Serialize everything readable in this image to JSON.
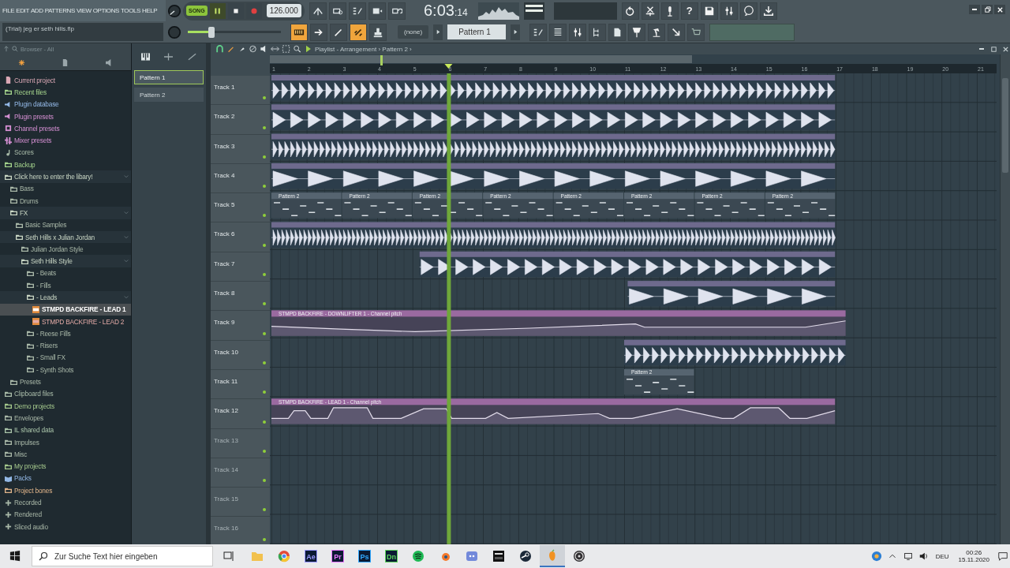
{
  "menu": [
    "FILE",
    "EDIT",
    "ADD",
    "PATTERNS",
    "VIEW",
    "OPTIONS",
    "TOOLS",
    "HELP"
  ],
  "hint": "(Trial) jeg er seth hills.flp",
  "transport": {
    "mode": "SONG",
    "playing": true,
    "tempo": "126.000"
  },
  "time": {
    "main": "6:03",
    "sub": ":14"
  },
  "master_volume": {
    "level": 0.25
  },
  "help_label": "?",
  "pattern_selector": {
    "channel": "(none)",
    "pattern": "Pattern 1"
  },
  "browser": {
    "title": "Browser - All",
    "items": [
      {
        "label": "Current project",
        "kind": "file",
        "color": "#d9a7b4"
      },
      {
        "label": "Recent files",
        "kind": "folder",
        "color": "#a4d38c"
      },
      {
        "label": "Plugin database",
        "kind": "plugin",
        "color": "#93b8e6"
      },
      {
        "label": "Plugin presets",
        "kind": "plugin",
        "color": "#d48fd2"
      },
      {
        "label": "Channel presets",
        "kind": "channel",
        "color": "#d48fd2"
      },
      {
        "label": "Mixer presets",
        "kind": "mixer",
        "color": "#d48fd2"
      },
      {
        "label": "Scores",
        "kind": "note",
        "color": "#a9bca9"
      },
      {
        "label": "Backup",
        "kind": "folder",
        "color": "#a4d38c"
      },
      {
        "label": "Click here to enter the libary!",
        "kind": "folder",
        "color": "#c9d6c4",
        "children": [
          {
            "label": "Bass",
            "kind": "folder",
            "color": "#a9b8a8"
          },
          {
            "label": "Drums",
            "kind": "folder",
            "color": "#a9b8a8"
          },
          {
            "label": "FX",
            "kind": "folder",
            "color": "#c9d6c4",
            "children": [
              {
                "label": "Basic Samples",
                "kind": "folder",
                "color": "#a9b8a8"
              },
              {
                "label": "Seth Hills x Julian Jordan",
                "kind": "folder",
                "color": "#c9d6c4",
                "children": [
                  {
                    "label": "Julian Jordan Style",
                    "kind": "folder",
                    "color": "#a9b8a8"
                  },
                  {
                    "label": "Seth Hills Style",
                    "kind": "folder",
                    "color": "#c9d6c4",
                    "children": [
                      {
                        "label": "- Beats",
                        "kind": "folder",
                        "color": "#a9b8a8"
                      },
                      {
                        "label": "- Fills",
                        "kind": "folder",
                        "color": "#a9b8a8"
                      },
                      {
                        "label": "- Leads",
                        "kind": "folder",
                        "color": "#c9d6c4",
                        "children": [
                          {
                            "label": "STMPD BACKFIRE - LEAD 1",
                            "kind": "audio",
                            "color": "#ffffff",
                            "selected": true
                          },
                          {
                            "label": "STMPD BACKFIRE - LEAD 2",
                            "kind": "audio",
                            "color": "#e3aaa6",
                            "selected": false
                          }
                        ]
                      },
                      {
                        "label": "- Reese Fills",
                        "kind": "folder",
                        "color": "#a9b8a8"
                      },
                      {
                        "label": "- Risers",
                        "kind": "folder",
                        "color": "#a9b8a8"
                      },
                      {
                        "label": "- Small FX",
                        "kind": "folder",
                        "color": "#a9b8a8"
                      },
                      {
                        "label": "- Synth Shots",
                        "kind": "folder",
                        "color": "#a9b8a8"
                      }
                    ]
                  }
                ]
              }
            ]
          },
          {
            "label": "Presets",
            "kind": "folder",
            "color": "#a9b8a8"
          }
        ]
      },
      {
        "label": "Clipboard files",
        "kind": "folder",
        "color": "#a9bca9"
      },
      {
        "label": "Demo projects",
        "kind": "folder",
        "color": "#a4c88c"
      },
      {
        "label": "Envelopes",
        "kind": "folder",
        "color": "#a9b8a8"
      },
      {
        "label": "IL shared data",
        "kind": "folder",
        "color": "#a9c4a9"
      },
      {
        "label": "Impulses",
        "kind": "folder",
        "color": "#a9b8a8"
      },
      {
        "label": "Misc",
        "kind": "folder",
        "color": "#a9b8a8"
      },
      {
        "label": "My projects",
        "kind": "folder",
        "color": "#a4c88c"
      },
      {
        "label": "Packs",
        "kind": "packs",
        "color": "#93b8e6"
      },
      {
        "label": "Project bones",
        "kind": "folder",
        "color": "#e0b48a"
      },
      {
        "label": "Recorded",
        "kind": "plus",
        "color": "#a9b8a8"
      },
      {
        "label": "Rendered",
        "kind": "plus",
        "color": "#a9b8a8"
      },
      {
        "label": "Sliced audio",
        "kind": "plus",
        "color": "#a9b8a8"
      }
    ]
  },
  "patterns": [
    {
      "label": "Pattern 1",
      "selected": true
    },
    {
      "label": "Pattern 2",
      "selected": false
    }
  ],
  "playlist": {
    "title": "Playlist - Arrangement › Pattern 2 ›",
    "bars": [
      "1",
      "2",
      "3",
      "4",
      "5",
      "6",
      "7",
      "8",
      "9",
      "10",
      "11",
      "12",
      "13",
      "14",
      "15",
      "16",
      "17",
      "18",
      "19",
      "20",
      "21"
    ],
    "tracks": [
      {
        "name": "Track 1",
        "clips": [
          {
            "kind": "audio"
          }
        ]
      },
      {
        "name": "Track 2",
        "clips": [
          {
            "kind": "audio"
          }
        ]
      },
      {
        "name": "Track 3",
        "clips": [
          {
            "kind": "audio"
          }
        ]
      },
      {
        "name": "Track 4",
        "clips": [
          {
            "kind": "audio"
          }
        ]
      },
      {
        "name": "Track 5",
        "clips": [
          {
            "kind": "pattern",
            "label": "Pattern 2"
          },
          {
            "kind": "pattern",
            "label": "Pattern 2"
          },
          {
            "kind": "pattern",
            "label": "Pattern 2"
          },
          {
            "kind": "pattern",
            "label": "Pattern 2"
          },
          {
            "kind": "pattern",
            "label": "Pattern 2"
          },
          {
            "kind": "pattern",
            "label": "Pattern 2"
          },
          {
            "kind": "pattern",
            "label": "Pattern 2"
          },
          {
            "kind": "pattern",
            "label": "Pattern 2"
          }
        ]
      },
      {
        "name": "Track 6",
        "clips": [
          {
            "kind": "audio"
          }
        ]
      },
      {
        "name": "Track 7",
        "clips": [
          {
            "kind": "audio"
          }
        ]
      },
      {
        "name": "Track 8",
        "clips": [
          {
            "kind": "audio"
          }
        ]
      },
      {
        "name": "Track 9",
        "clips": [
          {
            "kind": "automation",
            "label": "STMPD BACKFIRE - DOWNLIFTER 1 - Channel pitch"
          }
        ]
      },
      {
        "name": "Track 10",
        "clips": [
          {
            "kind": "audio"
          }
        ]
      },
      {
        "name": "Track 11",
        "clips": [
          {
            "kind": "pattern",
            "label": "Pattern 2"
          }
        ]
      },
      {
        "name": "Track 12",
        "clips": [
          {
            "kind": "automation",
            "label": "STMPD BACKFIRE - LEAD 1 - Channel pitch"
          }
        ]
      },
      {
        "name": "Track 13"
      },
      {
        "name": "Track 14"
      },
      {
        "name": "Track 15"
      },
      {
        "name": "Track 16"
      }
    ]
  },
  "taskbar": {
    "search": {
      "placeholder": "Zur Suche Text hier eingeben"
    },
    "apps": [
      {
        "kind": "folder",
        "active": false
      },
      {
        "kind": "browser",
        "active": false
      },
      {
        "kind": "tile",
        "label": "Ae",
        "color": "#9a9aff",
        "active": false
      },
      {
        "kind": "tile",
        "label": "Pr",
        "color": "#ea77ff",
        "active": false
      },
      {
        "kind": "tile",
        "label": "Ps",
        "color": "#31a8ff",
        "active": false
      },
      {
        "kind": "tile",
        "label": "Dn",
        "color": "#5dd65d",
        "active": false
      },
      {
        "kind": "music",
        "active": false
      },
      {
        "kind": "blender",
        "active": false
      },
      {
        "kind": "chat",
        "active": false
      },
      {
        "kind": "dark",
        "active": false
      },
      {
        "kind": "steam",
        "active": false
      },
      {
        "kind": "fruit",
        "active": true
      },
      {
        "kind": "record",
        "active": false
      }
    ],
    "language": "DEU",
    "time": "00:26",
    "date": "15.11.2020"
  }
}
